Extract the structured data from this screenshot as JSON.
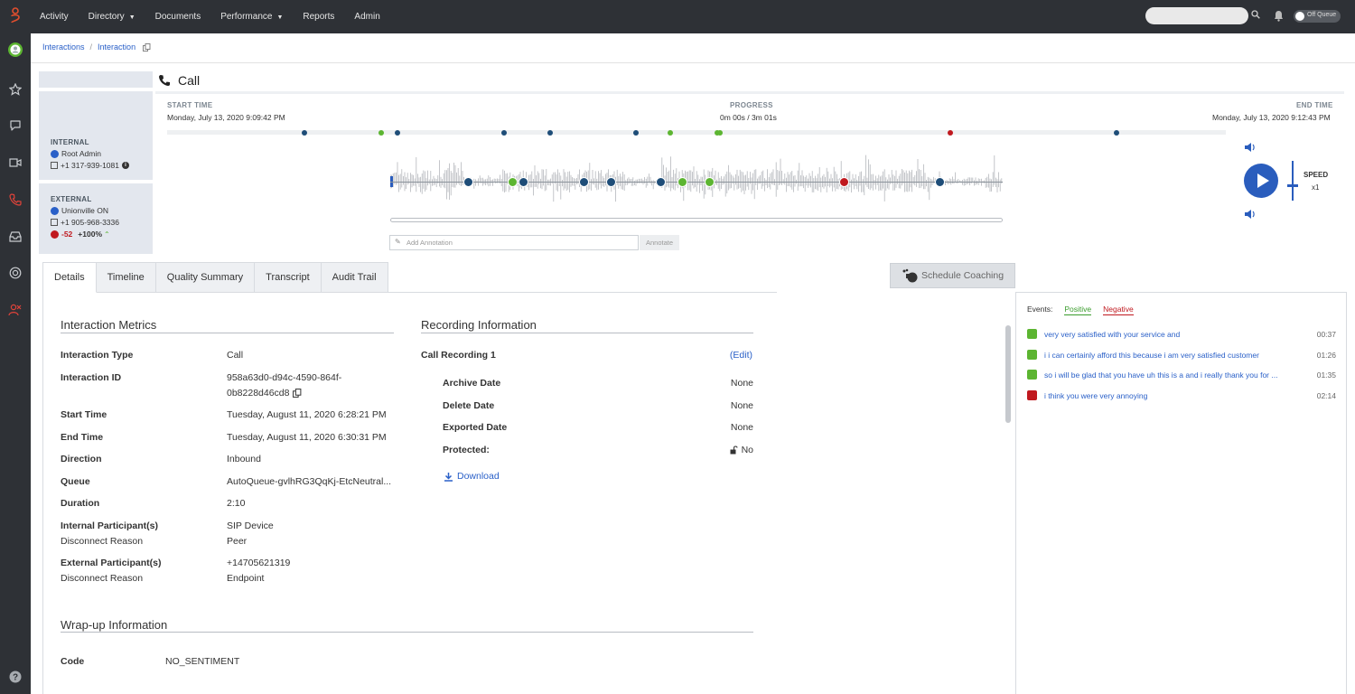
{
  "nav": {
    "items": [
      {
        "label": "Activity",
        "dropdown": false
      },
      {
        "label": "Directory",
        "dropdown": true
      },
      {
        "label": "Documents",
        "dropdown": false
      },
      {
        "label": "Performance",
        "dropdown": true
      },
      {
        "label": "Reports",
        "dropdown": false
      },
      {
        "label": "Admin",
        "dropdown": false
      }
    ],
    "search_value": "",
    "status_toggle": "Off Queue"
  },
  "sidebar": {
    "icons": [
      "avatar",
      "star-icon",
      "chat-icon",
      "video-icon",
      "phone-icon",
      "inbox-icon",
      "lifebuoy-icon",
      "users-icon"
    ],
    "help": "help-icon"
  },
  "breadcrumb": {
    "items": [
      "Interactions",
      "Interaction"
    ]
  },
  "interaction": {
    "title": "Call",
    "internal": {
      "label": "INTERNAL",
      "name": "Root Admin",
      "phone": "+1 317-939-1081"
    },
    "external": {
      "label": "EXTERNAL",
      "name": "Unionville ON",
      "phone": "+1 905-968-3336",
      "sentiment": "-52",
      "trend": "+100%"
    }
  },
  "player": {
    "start_label": "START TIME",
    "start_time": "Monday, July 13, 2020 9:09:42 PM",
    "progress_label": "PROGRESS",
    "progress": "0m 00s / 3m 01s",
    "end_label": "END TIME",
    "end_time": "Monday, July 13, 2020 9:12:43 PM",
    "annotation_placeholder": "Add Annotation",
    "annotate_label": "Annotate",
    "speed_label": "SPEED",
    "speed_value": "x1",
    "progress_fraction": 0.0,
    "track_markers": [
      {
        "pos": 0.13,
        "color": "#1e4d78"
      },
      {
        "pos": 0.202,
        "color": "#5cb531"
      },
      {
        "pos": 0.218,
        "color": "#1e4d78"
      },
      {
        "pos": 0.318,
        "color": "#1e4d78"
      },
      {
        "pos": 0.362,
        "color": "#1e4d78"
      },
      {
        "pos": 0.443,
        "color": "#1e4d78"
      },
      {
        "pos": 0.475,
        "color": "#5cb531"
      },
      {
        "pos": 0.52,
        "color": "#5cb531"
      },
      {
        "pos": 0.522,
        "color": "#5cb531"
      },
      {
        "pos": 0.74,
        "color": "#c0191f"
      },
      {
        "pos": 0.897,
        "color": "#1e4d78"
      }
    ],
    "wave_markers": [
      {
        "pos": 0.128,
        "kind": "bookmark"
      },
      {
        "pos": 0.2,
        "kind": "positive"
      },
      {
        "pos": 0.217,
        "kind": "bookmark"
      },
      {
        "pos": 0.317,
        "kind": "bookmark"
      },
      {
        "pos": 0.361,
        "kind": "bookmark"
      },
      {
        "pos": 0.442,
        "kind": "bookmark"
      },
      {
        "pos": 0.477,
        "kind": "positive"
      },
      {
        "pos": 0.522,
        "kind": "positive"
      },
      {
        "pos": 0.741,
        "kind": "negative"
      },
      {
        "pos": 0.897,
        "kind": "bookmark"
      }
    ]
  },
  "tabs": [
    "Details",
    "Timeline",
    "Quality Summary",
    "Transcript",
    "Audit Trail"
  ],
  "coaching": {
    "label": "Schedule Coaching"
  },
  "metrics": {
    "title": "Interaction Metrics",
    "rows": {
      "type": {
        "k": "Interaction Type",
        "v": "Call"
      },
      "id": {
        "k": "Interaction ID",
        "v1": "958a63d0-d94c-4590-864f-",
        "v2": "0b8228d46cd8"
      },
      "start": {
        "k": "Start Time",
        "v": "Tuesday, August 11, 2020 6:28:21 PM"
      },
      "end": {
        "k": "End Time",
        "v": "Tuesday, August 11, 2020 6:30:31 PM"
      },
      "direction": {
        "k": "Direction",
        "v": "Inbound"
      },
      "queue": {
        "k": "Queue",
        "v": "AutoQueue-gvlhRG3QqKj-EtcNeutral..."
      },
      "duration": {
        "k": "Duration",
        "v": "2:10"
      },
      "internal": {
        "k": "Internal Participant(s)",
        "v": "SIP Device",
        "sk": "Disconnect Reason",
        "sv": "Peer"
      },
      "external": {
        "k": "External Participant(s)",
        "v": "+14705621319",
        "sk": "Disconnect Reason",
        "sv": "Endpoint"
      }
    }
  },
  "recording": {
    "title": "Recording Information",
    "name": "Call Recording 1",
    "edit": "(Edit)",
    "archive": {
      "k": "Archive Date",
      "v": "None"
    },
    "delete": {
      "k": "Delete Date",
      "v": "None"
    },
    "exported": {
      "k": "Exported Date",
      "v": "None"
    },
    "protected": {
      "k": "Protected:",
      "v": "No"
    },
    "download": "Download"
  },
  "wrapup": {
    "title": "Wrap-up Information",
    "code_label": "Code",
    "code_value": "NO_SENTIMENT"
  },
  "events": {
    "label": "Events:",
    "positive": "Positive",
    "negative": "Negative",
    "items": [
      {
        "kind": "positive",
        "text": "very very satisfied with your service and",
        "time": "00:37"
      },
      {
        "kind": "positive",
        "text": "i i can certainly afford this because i am very satisfied customer",
        "time": "01:26"
      },
      {
        "kind": "positive",
        "text": "so i will be glad that you have uh this is a and i really thank you for ...",
        "time": "01:35"
      },
      {
        "kind": "negative",
        "text": "i think you were very annoying",
        "time": "02:14"
      }
    ]
  }
}
